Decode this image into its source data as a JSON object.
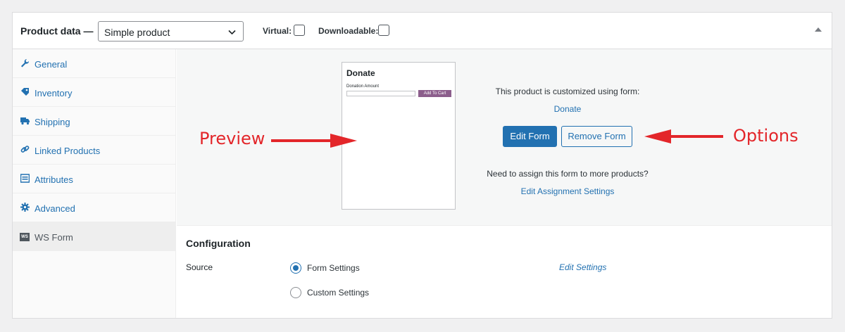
{
  "header": {
    "title": "Product data —",
    "product_type": "Simple product",
    "virtual_label": "Virtual:",
    "downloadable_label": "Downloadable:"
  },
  "tabs": [
    {
      "label": "General",
      "icon": "wrench-icon"
    },
    {
      "label": "Inventory",
      "icon": "tag-icon"
    },
    {
      "label": "Shipping",
      "icon": "truck-icon"
    },
    {
      "label": "Linked Products",
      "icon": "link-icon"
    },
    {
      "label": "Attributes",
      "icon": "list-icon"
    },
    {
      "label": "Advanced",
      "icon": "gear-icon"
    },
    {
      "label": "WS Form",
      "icon": "wsform-icon",
      "badge": "WS"
    }
  ],
  "preview": {
    "title": "Donate",
    "field_label": "Donation Amount",
    "button": "Add To Cart"
  },
  "form_info": {
    "customized_text": "This product is customized using form:",
    "form_name": "Donate",
    "edit_button": "Edit Form",
    "remove_button": "Remove Form",
    "assign_text": "Need to assign this form to more products?",
    "assign_link": "Edit Assignment Settings"
  },
  "annotations": {
    "preview": "Preview",
    "options": "Options"
  },
  "configuration": {
    "heading": "Configuration",
    "source_label": "Source",
    "options": [
      "Form Settings",
      "Custom Settings"
    ],
    "selected": "Form Settings",
    "edit_settings": "Edit Settings"
  },
  "colors": {
    "accent": "#2271b1",
    "annotation": "#e3262a",
    "preview_button": "#8c5e8c"
  }
}
